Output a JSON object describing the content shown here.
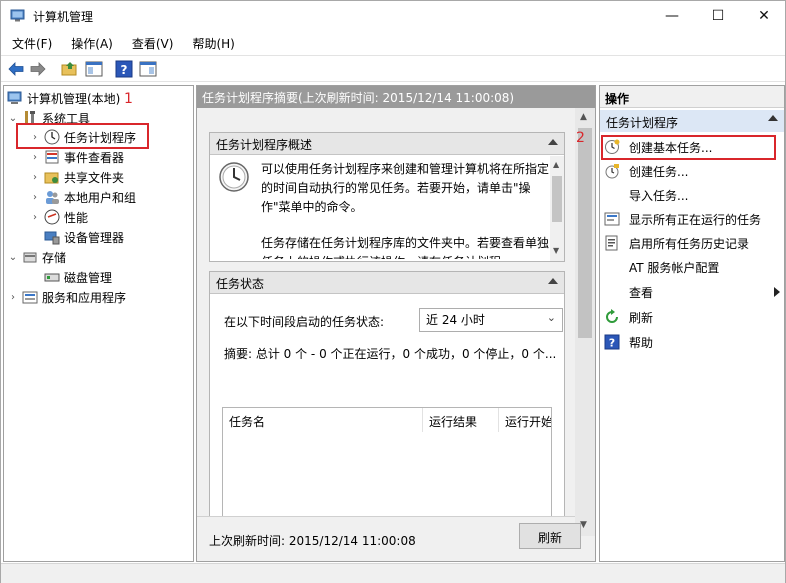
{
  "window": {
    "title": "计算机管理",
    "minimize": "—",
    "maximize": "☐",
    "close": "✕"
  },
  "menu": [
    "文件(F)",
    "操作(A)",
    "查看(V)",
    "帮助(H)"
  ],
  "tree": {
    "root": "计算机管理(本地)",
    "system_tools": "系统工具",
    "task_scheduler": "任务计划程序",
    "event_viewer": "事件查看器",
    "shared_folders": "共享文件夹",
    "local_users": "本地用户和组",
    "performance": "性能",
    "device_manager": "设备管理器",
    "storage": "存储",
    "disk_management": "磁盘管理",
    "services_apps": "服务和应用程序"
  },
  "annotations": {
    "num1": "1",
    "num2": "2"
  },
  "center": {
    "header": "任务计划程序摘要(上次刷新时间: 2015/12/14 11:00:08)",
    "overview_title": "任务计划程序概述",
    "overview_p1": "可以使用任务计划程序来创建和管理计算机将在所指定的时间自动执行的常见任务。若要开始，请单击\"操作\"菜单中的命令。",
    "overview_p2": "任务存储在任务计划程序库的文件夹中。若要查看单独任务上的操作或执行该操作，请在任务计划程",
    "status_title": "任务状态",
    "status_label": "在以下时间段启动的任务状态:",
    "status_combo": "近 24 小时",
    "summary": "摘要: 总计 0 个 - 0 个正在运行，0 个成功，0 个停止，0 个...",
    "columns": [
      "任务名",
      "运行结果",
      "运行开始时"
    ],
    "last_refresh": "上次刷新时间: 2015/12/14 11:00:08",
    "refresh_btn": "刷新"
  },
  "actions": {
    "title": "操作",
    "subtitle": "任务计划程序",
    "items": [
      "创建基本任务...",
      "创建任务...",
      "导入任务...",
      "显示所有正在运行的任务",
      "启用所有任务历史记录",
      "AT 服务帐户配置",
      "查看",
      "刷新",
      "帮助"
    ]
  },
  "colors": {
    "accent_red": "#d9262b",
    "header_gray": "#9a9a9a",
    "selection_blue": "#dce7f5"
  }
}
